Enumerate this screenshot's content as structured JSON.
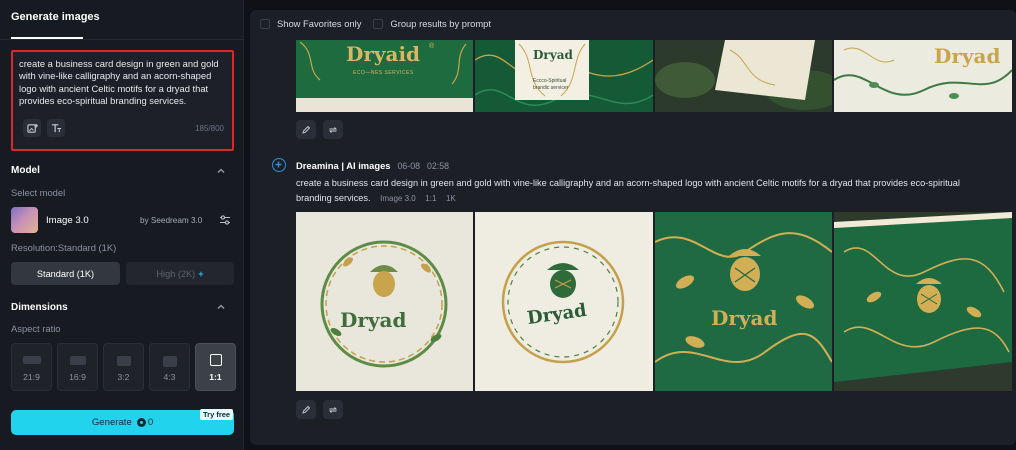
{
  "left_panel": {
    "tab_label": "Generate images",
    "prompt": {
      "text": "create a business card design in green and gold with vine-like calligraphy and an acorn-shaped logo with ancient Celtic motifs for a dryad that provides eco-spiritual branding services.",
      "char_count": "185/800",
      "tools": [
        "image-reference-icon",
        "text-style-icon"
      ]
    },
    "model_section": {
      "title": "Model",
      "select_label": "Select model",
      "model_name": "Image 3.0",
      "model_by": "by Seedream 3.0",
      "resolution_label": "Resolution:Standard (1K)",
      "resolution_options": [
        "Standard (1K)",
        "High (2K)"
      ]
    },
    "dimensions_section": {
      "title": "Dimensions",
      "aspect_label": "Aspect ratio",
      "aspect_options": [
        "21:9",
        "16:9",
        "3:2",
        "4:3",
        "1:1"
      ],
      "selected_aspect": "1:1"
    },
    "generate": {
      "label": "Generate",
      "cost": "0",
      "badge": "Try free"
    }
  },
  "toolbar": {
    "show_favorites": "Show Favorites only",
    "group_results": "Group results by prompt"
  },
  "generation": {
    "author": "Dreamina | AI images",
    "date": "06-08",
    "time": "02:58",
    "prompt": "create a business card design in green and gold with vine-like calligraphy and an acorn-shaped logo with ancient Celtic motifs for a dryad that provides eco-spiritual branding services.",
    "model": "Image 3.0",
    "ratio": "1:1",
    "resolution": "1K"
  },
  "card_text": {
    "brand": "Dryaid",
    "brand_reg": "®",
    "tagline_top": "ECO—NES SERVICES",
    "tagline_mid1": "Eccco-Spiritual",
    "tagline_mid2": "brandic servicer",
    "brand_main": "Dryad"
  }
}
